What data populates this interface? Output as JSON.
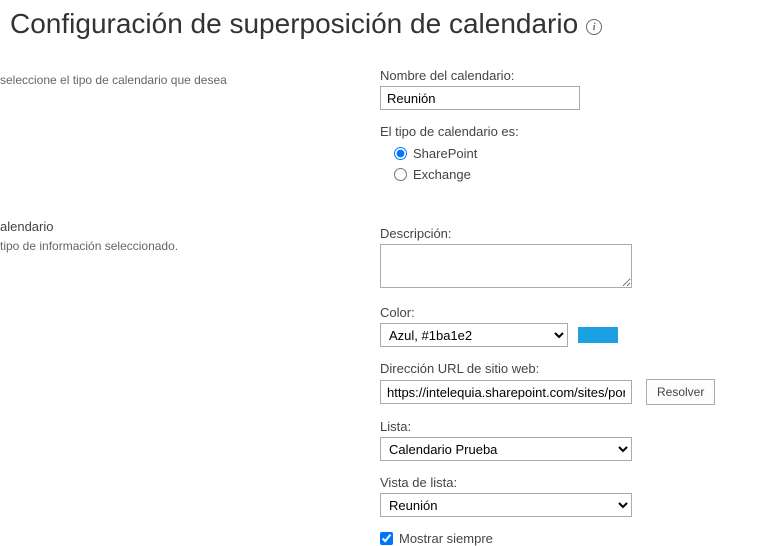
{
  "page": {
    "title": "Configuración de superposición de calendario"
  },
  "leftSections": {
    "s1": {
      "help": "seleccione el tipo de calendario que desea"
    },
    "s2": {
      "label": "alendario",
      "help": "tipo de información seleccionado."
    }
  },
  "fields": {
    "nameLabel": "Nombre del calendario:",
    "nameValue": "Reunión",
    "calendarTypeLabel": "El tipo de calendario es:",
    "radioSharePoint": "SharePoint",
    "radioExchange": "Exchange",
    "descriptionLabel": "Descripción:",
    "descriptionValue": "",
    "colorLabel": "Color:",
    "colorSelected": "Azul, #1ba1e2",
    "colorHex": "#1ba1e2",
    "urlLabel": "Dirección URL de sitio web:",
    "urlValue": "https://intelequia.sharepoint.com/sites/portal",
    "resolveButton": "Resolver",
    "listLabel": "Lista:",
    "listSelected": "Calendario Prueba",
    "viewLabel": "Vista de lista:",
    "viewSelected": "Reunión",
    "alwaysShow": "Mostrar siempre"
  }
}
